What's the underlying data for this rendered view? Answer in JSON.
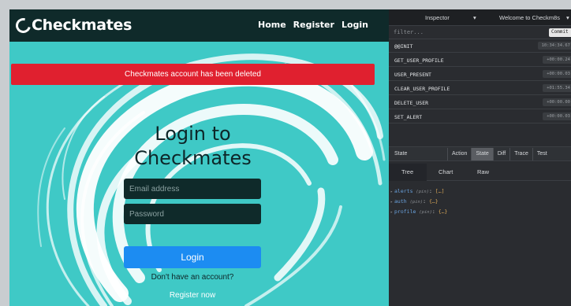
{
  "app": {
    "brand": "Checkmates",
    "nav": [
      "Home",
      "Register",
      "Login"
    ],
    "alert": "Checkmates account has been deleted",
    "login": {
      "title": "Login to Checkmates",
      "email_placeholder": "Email address",
      "password_placeholder": "Password",
      "button": "Login",
      "no_account": "Don't have an account?",
      "register_now": "Register now"
    },
    "colors": {
      "background": "#3fc9c6",
      "navbar": "#0f2a2a",
      "alert": "#e0202f",
      "button": "#1c8cf2"
    }
  },
  "devtools": {
    "header": {
      "left": "Inspector",
      "right": "Welcome to Checkm8s"
    },
    "filter_placeholder": "filter...",
    "commit_label": "Commit",
    "actions": [
      {
        "name": "@@INIT",
        "time": "10:34:34.67"
      },
      {
        "name": "GET_USER_PROFILE",
        "time": "+00:00.24"
      },
      {
        "name": "USER_PRESENT",
        "time": "+00:00.03"
      },
      {
        "name": "CLEAR_USER_PROFILE",
        "time": "+01:55.34"
      },
      {
        "name": "DELETE_USER",
        "time": "+00:00.00"
      },
      {
        "name": "SET_ALERT",
        "time": "+00:00.03"
      }
    ],
    "state_label": "State",
    "state_tabs": [
      "Action",
      "State",
      "Diff",
      "Trace",
      "Test"
    ],
    "sub_tabs": [
      "Tree",
      "Chart",
      "Raw"
    ],
    "tree": [
      {
        "key": "alerts",
        "type": "(pin)",
        "value": "[…]"
      },
      {
        "key": "auth",
        "type": "(pin)",
        "value": "{…}"
      },
      {
        "key": "profile",
        "type": "(pin)",
        "value": "{…}"
      }
    ]
  }
}
